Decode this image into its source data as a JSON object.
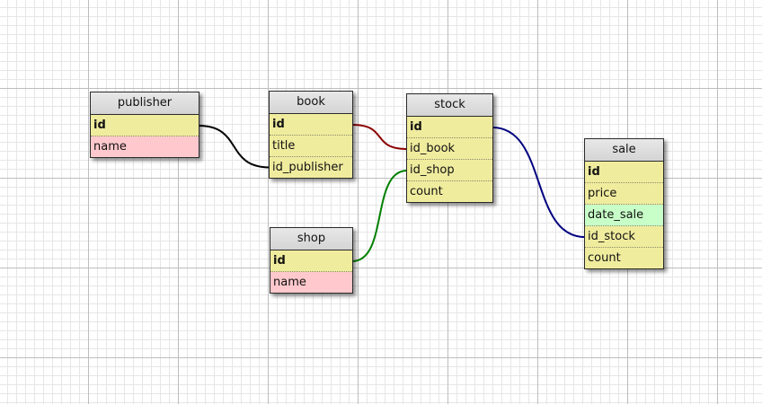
{
  "colors": {
    "field_default": "#f0ec9e",
    "field_pink": "#ffc8cc",
    "field_green": "#c8ffc8",
    "link_publisher": "#000000",
    "link_book": "#8b0000",
    "link_shop": "#008000",
    "link_stock": "#000080"
  },
  "tables": {
    "publisher": {
      "title": "publisher",
      "fields": [
        "id",
        "name"
      ]
    },
    "book": {
      "title": "book",
      "fields": [
        "id",
        "title",
        "id_publisher"
      ]
    },
    "stock": {
      "title": "stock",
      "fields": [
        "id",
        "id_book",
        "id_shop",
        "count"
      ]
    },
    "shop": {
      "title": "shop",
      "fields": [
        "id",
        "name"
      ]
    },
    "sale": {
      "title": "sale",
      "fields": [
        "id",
        "price",
        "date_sale",
        "id_stock",
        "count"
      ]
    }
  },
  "relations": [
    {
      "from": "publisher.id",
      "to": "book.id_publisher",
      "color": "#000000"
    },
    {
      "from": "book.id",
      "to": "stock.id_book",
      "color": "#8b0000"
    },
    {
      "from": "shop.id",
      "to": "stock.id_shop",
      "color": "#008000"
    },
    {
      "from": "stock.id",
      "to": "sale.id_stock",
      "color": "#000080"
    }
  ]
}
